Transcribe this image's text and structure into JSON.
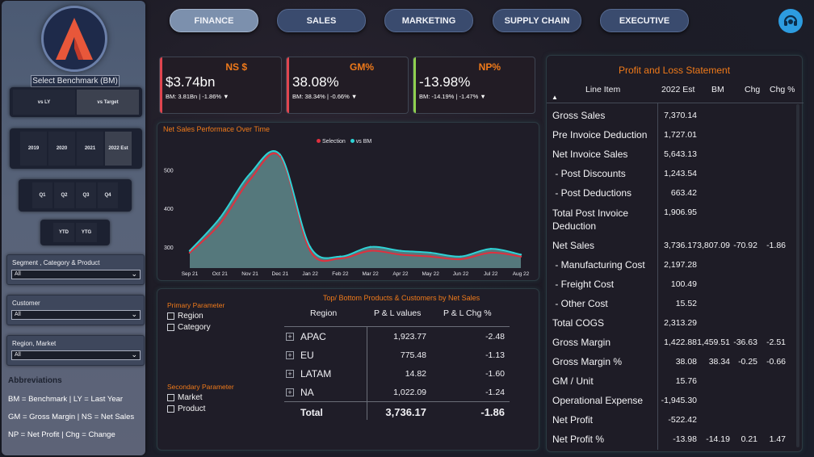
{
  "nav": {
    "tabs": [
      "FINANCE",
      "SALES",
      "MARKETING",
      "SUPPLY CHAIN",
      "EXECUTIVE"
    ],
    "active_tab": "FINANCE"
  },
  "sidebar": {
    "benchmark_label": "Select Benchmark (BM)",
    "benchmark_options": [
      "vs LY",
      "vs Target"
    ],
    "benchmark_selected": "vs Target",
    "years": [
      "2019",
      "2020",
      "2021",
      "2022 Est"
    ],
    "year_selected": "2022 Est",
    "quarters": [
      "Q1",
      "Q2",
      "Q3",
      "Q4"
    ],
    "periods": [
      "YTD",
      "YTG"
    ],
    "filters": [
      {
        "label": "Segment , Category & Product",
        "value": "All"
      },
      {
        "label": "Customer",
        "value": "All"
      },
      {
        "label": "Region, Market",
        "value": "All"
      }
    ],
    "abbreviations_title": "Abbreviations",
    "abbreviations": [
      "BM = Benchmark | LY = Last Year",
      "GM = Gross Margin | NS = Net Sales",
      "NP = Net Profit | Chg = Change"
    ]
  },
  "kpis": [
    {
      "title": "NS $",
      "value": "$3.74bn",
      "sub": "BM: 3.81Bn | -1.86% ▼",
      "accent": "#e0454f"
    },
    {
      "title": "GM%",
      "value": "38.08%",
      "sub": "BM: 38.34% | -0.66% ▼",
      "accent": "#e0454f"
    },
    {
      "title": "NP%",
      "value": "-13.98%",
      "sub": "BM: -14.19% | -1.47% ▼",
      "accent": "#8fd14f"
    }
  ],
  "chart": {
    "title": "Net Sales Performace Over Time",
    "legend": [
      {
        "name": "Selection",
        "color": "#e0303e"
      },
      {
        "name": "vs BM",
        "color": "#2ed3d6"
      }
    ]
  },
  "chart_data": {
    "type": "area",
    "title": "Net Sales Performace Over Time",
    "categories": [
      "Sep 21",
      "Oct 21",
      "Nov 21",
      "Dec 21",
      "Jan 22",
      "Feb 22",
      "Mar 22",
      "Apr 22",
      "May 22",
      "Jun 22",
      "Jul 22",
      "Aug 22"
    ],
    "ylim": [
      245,
      560
    ],
    "y_ticks": [
      300,
      400,
      500
    ],
    "series": [
      {
        "name": "Selection",
        "values": [
          285,
          360,
          475,
          535,
          290,
          270,
          290,
          280,
          275,
          268,
          285,
          275
        ]
      },
      {
        "name": "vs BM",
        "values": [
          290,
          375,
          490,
          540,
          300,
          275,
          300,
          290,
          285,
          275,
          295,
          280
        ]
      }
    ]
  },
  "region_table": {
    "title": "Top/ Bottom Products & Customers by Net Sales",
    "primary_label": "Primary Parameter",
    "primary_options": [
      "Region",
      "Category"
    ],
    "secondary_label": "Secondary Parameter",
    "secondary_options": [
      "Market",
      "Product"
    ],
    "headers": [
      "Region",
      "P & L values",
      "P & L Chg %"
    ],
    "rows": [
      {
        "region": "APAC",
        "value": "1,923.77",
        "chg": "-2.48"
      },
      {
        "region": "EU",
        "value": "775.48",
        "chg": "-1.13"
      },
      {
        "region": "LATAM",
        "value": "14.82",
        "chg": "-1.60"
      },
      {
        "region": "NA",
        "value": "1,022.09",
        "chg": "-1.24"
      }
    ],
    "total": {
      "label": "Total",
      "value": "3,736.17",
      "chg": "-1.86"
    }
  },
  "pl": {
    "title": "Profit and Loss Statement",
    "headers": [
      "Line Item",
      "2022 Est",
      "BM",
      "Chg",
      "Chg %"
    ],
    "rows": [
      {
        "item": "Gross Sales",
        "est": "7,370.14",
        "bm": "",
        "chg": "",
        "chgp": ""
      },
      {
        "item": "Pre Invoice Deduction",
        "est": "1,727.01",
        "bm": "",
        "chg": "",
        "chgp": ""
      },
      {
        "item": "Net Invoice Sales",
        "est": "5,643.13",
        "bm": "",
        "chg": "",
        "chgp": ""
      },
      {
        "item": " - Post Discounts",
        "est": "1,243.54",
        "bm": "",
        "chg": "",
        "chgp": ""
      },
      {
        "item": " - Post Deductions",
        "est": "663.42",
        "bm": "",
        "chg": "",
        "chgp": ""
      },
      {
        "item": "Total Post Invoice Deduction",
        "est": "1,906.95",
        "bm": "",
        "chg": "",
        "chgp": ""
      },
      {
        "item": "Net Sales",
        "est": "3,736.17",
        "bm": "3,807.09",
        "chg": "-70.92",
        "chgp": "-1.86"
      },
      {
        "item": " - Manufacturing Cost",
        "est": "2,197.28",
        "bm": "",
        "chg": "",
        "chgp": ""
      },
      {
        "item": " - Freight Cost",
        "est": "100.49",
        "bm": "",
        "chg": "",
        "chgp": ""
      },
      {
        "item": " - Other Cost",
        "est": "15.52",
        "bm": "",
        "chg": "",
        "chgp": ""
      },
      {
        "item": "Total COGS",
        "est": "2,313.29",
        "bm": "",
        "chg": "",
        "chgp": ""
      },
      {
        "item": "Gross Margin",
        "est": "1,422.88",
        "bm": "1,459.51",
        "chg": "-36.63",
        "chgp": "-2.51"
      },
      {
        "item": "Gross Margin %",
        "est": "38.08",
        "bm": "38.34",
        "chg": "-0.25",
        "chgp": "-0.66"
      },
      {
        "item": "GM / Unit",
        "est": "15.76",
        "bm": "",
        "chg": "",
        "chgp": ""
      },
      {
        "item": "Operational Expense",
        "est": "-1,945.30",
        "bm": "",
        "chg": "",
        "chgp": ""
      },
      {
        "item": "Net Profit",
        "est": "-522.42",
        "bm": "",
        "chg": "",
        "chgp": ""
      },
      {
        "item": "Net Profit %",
        "est": "-13.98",
        "bm": "-14.19",
        "chg": "0.21",
        "chgp": "1.47"
      }
    ]
  }
}
